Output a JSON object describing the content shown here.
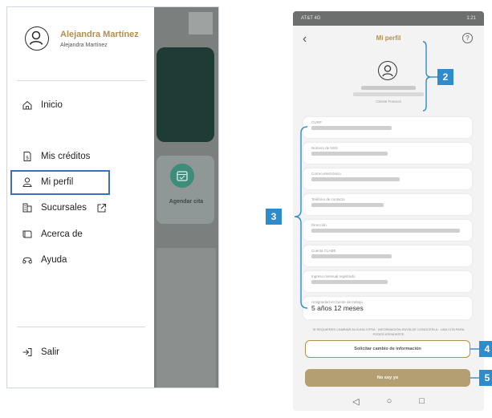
{
  "drawer": {
    "user_name": "Alejandra Martínez",
    "user_subname": "Alejandra Martínez",
    "items": [
      {
        "label": "Inicio",
        "icon": "home-icon"
      },
      {
        "label": "Mis créditos",
        "icon": "document-dollar-icon"
      },
      {
        "label": "Mi perfil",
        "icon": "person-icon",
        "selected": true
      },
      {
        "label": "Sucursales",
        "icon": "building-icon",
        "external_icon": "external-link-icon"
      },
      {
        "label": "Acerca de",
        "icon": "info-card-icon"
      },
      {
        "label": "Ayuda",
        "icon": "headset-icon"
      }
    ],
    "logout_label": "Salir"
  },
  "background_screen": {
    "schedule_label": "Agendar cita"
  },
  "profile_screen": {
    "status_left": "AT&T 4G",
    "status_right": "1:21",
    "title": "Mi perfil",
    "client_label": "Cliente Fonacot",
    "fields": [
      {
        "label": "CURP"
      },
      {
        "label": "Número de NSS"
      },
      {
        "label": "Correo electrónico"
      },
      {
        "label": "Teléfono de contacto"
      },
      {
        "label": "Dirección"
      },
      {
        "label": "Cuenta CLABE"
      },
      {
        "label": "Ingreso mensual registrado"
      },
      {
        "label": "Antigüedad en fuente de trabajo",
        "value": "5 años 12 meses"
      }
    ],
    "note": "SI REQUIERES CAMBIAR ALGUNA CIFRA · INFORMACIÓN ENVÍA DE CONOCERLA · UNA CITA PARA PODER ATENDERTE",
    "request_change_button": "Solicitar cambio de información",
    "not_me_button": "No soy yo"
  },
  "callouts": [
    "2",
    "3",
    "4",
    "5"
  ],
  "colors": {
    "accent_gold": "#b38f4e",
    "callout_blue": "#2f8ccc",
    "selection_blue": "#3d6ec6"
  }
}
